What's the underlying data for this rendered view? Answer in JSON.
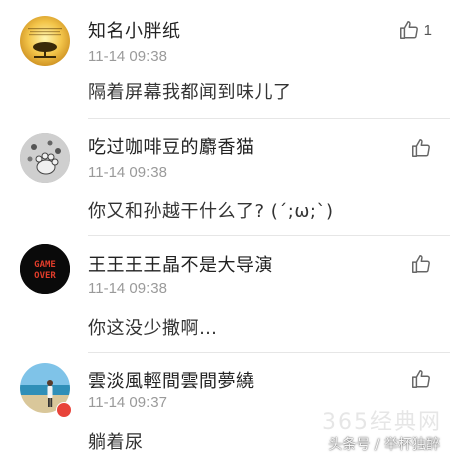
{
  "comments": [
    {
      "username": "知名小胖纸",
      "time": "11-14 09:38",
      "text": "隔着屏幕我都闻到味儿了",
      "likes": "1",
      "avatar": "tree-sunset-avatar"
    },
    {
      "username": "吃过咖啡豆的麝香猫",
      "time": "11-14 09:38",
      "text": "你又和孙越干什么了? (´;ω;`)",
      "likes": "",
      "avatar": "cat-paw-avatar"
    },
    {
      "username": "王王王王晶不是大导演",
      "time": "11-14 09:38",
      "text": "你这没少撒啊…",
      "likes": "",
      "avatar": "game-over-avatar",
      "avatar_text_line1": "GAME",
      "avatar_text_line2": "OVER"
    },
    {
      "username": "雲淡風輕間雲間夢繞",
      "time": "11-14 09:37",
      "text": "躺着尿",
      "likes": "",
      "avatar": "beach-person-avatar"
    }
  ],
  "watermark": {
    "site": "365经典网",
    "source": "头条号 / 举杯独醉"
  },
  "colors": {
    "username": "#222222",
    "time": "#9a9a9a",
    "text": "#333333",
    "divider": "#e6e6e6",
    "like_icon": "#666666"
  }
}
